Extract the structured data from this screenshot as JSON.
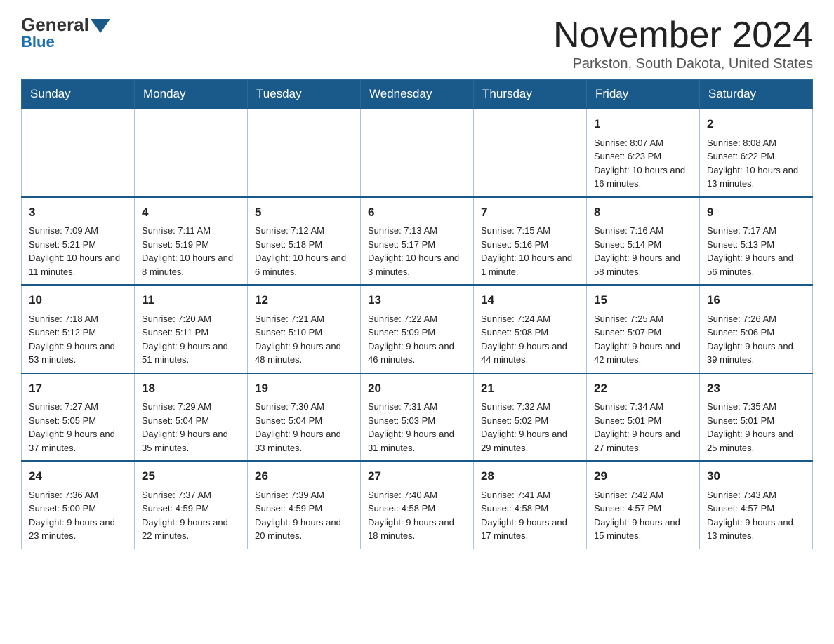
{
  "logo": {
    "general": "General",
    "blue": "Blue"
  },
  "title": "November 2024",
  "location": "Parkston, South Dakota, United States",
  "weekdays": [
    "Sunday",
    "Monday",
    "Tuesday",
    "Wednesday",
    "Thursday",
    "Friday",
    "Saturday"
  ],
  "weeks": [
    [
      {
        "day": "",
        "info": ""
      },
      {
        "day": "",
        "info": ""
      },
      {
        "day": "",
        "info": ""
      },
      {
        "day": "",
        "info": ""
      },
      {
        "day": "",
        "info": ""
      },
      {
        "day": "1",
        "info": "Sunrise: 8:07 AM\nSunset: 6:23 PM\nDaylight: 10 hours and 16 minutes."
      },
      {
        "day": "2",
        "info": "Sunrise: 8:08 AM\nSunset: 6:22 PM\nDaylight: 10 hours and 13 minutes."
      }
    ],
    [
      {
        "day": "3",
        "info": "Sunrise: 7:09 AM\nSunset: 5:21 PM\nDaylight: 10 hours and 11 minutes."
      },
      {
        "day": "4",
        "info": "Sunrise: 7:11 AM\nSunset: 5:19 PM\nDaylight: 10 hours and 8 minutes."
      },
      {
        "day": "5",
        "info": "Sunrise: 7:12 AM\nSunset: 5:18 PM\nDaylight: 10 hours and 6 minutes."
      },
      {
        "day": "6",
        "info": "Sunrise: 7:13 AM\nSunset: 5:17 PM\nDaylight: 10 hours and 3 minutes."
      },
      {
        "day": "7",
        "info": "Sunrise: 7:15 AM\nSunset: 5:16 PM\nDaylight: 10 hours and 1 minute."
      },
      {
        "day": "8",
        "info": "Sunrise: 7:16 AM\nSunset: 5:14 PM\nDaylight: 9 hours and 58 minutes."
      },
      {
        "day": "9",
        "info": "Sunrise: 7:17 AM\nSunset: 5:13 PM\nDaylight: 9 hours and 56 minutes."
      }
    ],
    [
      {
        "day": "10",
        "info": "Sunrise: 7:18 AM\nSunset: 5:12 PM\nDaylight: 9 hours and 53 minutes."
      },
      {
        "day": "11",
        "info": "Sunrise: 7:20 AM\nSunset: 5:11 PM\nDaylight: 9 hours and 51 minutes."
      },
      {
        "day": "12",
        "info": "Sunrise: 7:21 AM\nSunset: 5:10 PM\nDaylight: 9 hours and 48 minutes."
      },
      {
        "day": "13",
        "info": "Sunrise: 7:22 AM\nSunset: 5:09 PM\nDaylight: 9 hours and 46 minutes."
      },
      {
        "day": "14",
        "info": "Sunrise: 7:24 AM\nSunset: 5:08 PM\nDaylight: 9 hours and 44 minutes."
      },
      {
        "day": "15",
        "info": "Sunrise: 7:25 AM\nSunset: 5:07 PM\nDaylight: 9 hours and 42 minutes."
      },
      {
        "day": "16",
        "info": "Sunrise: 7:26 AM\nSunset: 5:06 PM\nDaylight: 9 hours and 39 minutes."
      }
    ],
    [
      {
        "day": "17",
        "info": "Sunrise: 7:27 AM\nSunset: 5:05 PM\nDaylight: 9 hours and 37 minutes."
      },
      {
        "day": "18",
        "info": "Sunrise: 7:29 AM\nSunset: 5:04 PM\nDaylight: 9 hours and 35 minutes."
      },
      {
        "day": "19",
        "info": "Sunrise: 7:30 AM\nSunset: 5:04 PM\nDaylight: 9 hours and 33 minutes."
      },
      {
        "day": "20",
        "info": "Sunrise: 7:31 AM\nSunset: 5:03 PM\nDaylight: 9 hours and 31 minutes."
      },
      {
        "day": "21",
        "info": "Sunrise: 7:32 AM\nSunset: 5:02 PM\nDaylight: 9 hours and 29 minutes."
      },
      {
        "day": "22",
        "info": "Sunrise: 7:34 AM\nSunset: 5:01 PM\nDaylight: 9 hours and 27 minutes."
      },
      {
        "day": "23",
        "info": "Sunrise: 7:35 AM\nSunset: 5:01 PM\nDaylight: 9 hours and 25 minutes."
      }
    ],
    [
      {
        "day": "24",
        "info": "Sunrise: 7:36 AM\nSunset: 5:00 PM\nDaylight: 9 hours and 23 minutes."
      },
      {
        "day": "25",
        "info": "Sunrise: 7:37 AM\nSunset: 4:59 PM\nDaylight: 9 hours and 22 minutes."
      },
      {
        "day": "26",
        "info": "Sunrise: 7:39 AM\nSunset: 4:59 PM\nDaylight: 9 hours and 20 minutes."
      },
      {
        "day": "27",
        "info": "Sunrise: 7:40 AM\nSunset: 4:58 PM\nDaylight: 9 hours and 18 minutes."
      },
      {
        "day": "28",
        "info": "Sunrise: 7:41 AM\nSunset: 4:58 PM\nDaylight: 9 hours and 17 minutes."
      },
      {
        "day": "29",
        "info": "Sunrise: 7:42 AM\nSunset: 4:57 PM\nDaylight: 9 hours and 15 minutes."
      },
      {
        "day": "30",
        "info": "Sunrise: 7:43 AM\nSunset: 4:57 PM\nDaylight: 9 hours and 13 minutes."
      }
    ]
  ]
}
